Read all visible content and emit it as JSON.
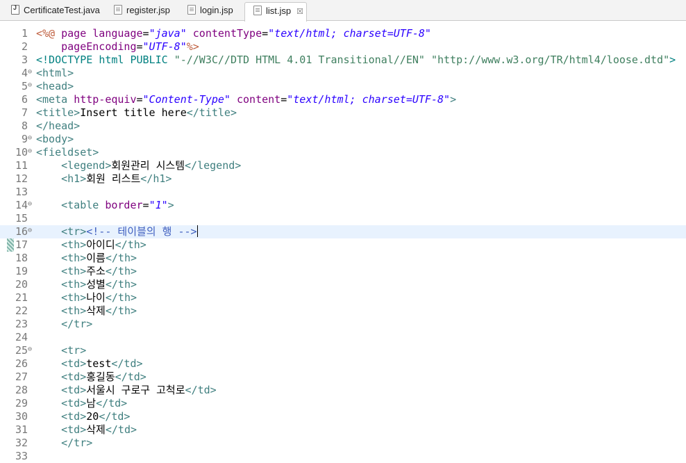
{
  "tabs": [
    {
      "label": "CertificateTest.java",
      "icon": "java-file-icon"
    },
    {
      "label": "register.jsp",
      "icon": "jsp-file-icon"
    },
    {
      "label": "login.jsp",
      "icon": "jsp-file-icon"
    },
    {
      "label": "list.jsp",
      "icon": "jsp-file-icon",
      "active": true
    }
  ],
  "tab_close_glyph": "☒",
  "fold_glyph": "⊖",
  "current_line": 16,
  "lines": [
    {
      "n": "1",
      "code": [
        [
          "dir",
          "<%@ "
        ],
        [
          "attr",
          "page "
        ],
        [
          "attr",
          "language"
        ],
        [
          "",
          "="
        ],
        [
          "val",
          "\"java\""
        ],
        [
          "",
          ""
        ],
        [
          "attr",
          " contentType"
        ],
        [
          "",
          "="
        ],
        [
          "val",
          "\"text/html; charset=UTF-8\""
        ]
      ]
    },
    {
      "n": "2",
      "code": [
        [
          "",
          "    "
        ],
        [
          "attr",
          "pageEncoding"
        ],
        [
          "",
          "="
        ],
        [
          "val",
          "\"UTF-8\""
        ],
        [
          "dir",
          "%>"
        ]
      ]
    },
    {
      "n": "3",
      "code": [
        [
          "dt",
          "<!DOCTYPE "
        ],
        [
          "dt",
          "html "
        ],
        [
          "dt",
          "PUBLIC "
        ],
        [
          "dstr",
          "\"-//W3C//DTD HTML 4.01 Transitional//EN\" \"http://www.w3.org/TR/html4/loose.dtd\""
        ],
        [
          "dt",
          ">"
        ]
      ]
    },
    {
      "n": "4",
      "fold": true,
      "code": [
        [
          "tag",
          "<html>"
        ]
      ]
    },
    {
      "n": "5",
      "fold": true,
      "code": [
        [
          "tag",
          "<head>"
        ]
      ]
    },
    {
      "n": "6",
      "code": [
        [
          "tag",
          "<meta "
        ],
        [
          "attr",
          "http-equiv"
        ],
        [
          "",
          "="
        ],
        [
          "val",
          "\"Content-Type\""
        ],
        [
          "attr",
          " content"
        ],
        [
          "",
          "="
        ],
        [
          "val",
          "\"text/html; charset=UTF-8\""
        ],
        [
          "tag",
          ">"
        ]
      ]
    },
    {
      "n": "7",
      "code": [
        [
          "tag",
          "<title>"
        ],
        [
          "",
          "Insert title here"
        ],
        [
          "tag",
          "</title>"
        ]
      ]
    },
    {
      "n": "8",
      "code": [
        [
          "tag",
          "</head>"
        ]
      ]
    },
    {
      "n": "9",
      "fold": true,
      "code": [
        [
          "tag",
          "<body>"
        ]
      ]
    },
    {
      "n": "10",
      "fold": true,
      "code": [
        [
          "tag",
          "<fieldset>"
        ]
      ]
    },
    {
      "n": "11",
      "code": [
        [
          "",
          "    "
        ],
        [
          "tag",
          "<legend>"
        ],
        [
          "",
          "회원관리 시스템"
        ],
        [
          "tag",
          "</legend>"
        ]
      ]
    },
    {
      "n": "12",
      "code": [
        [
          "",
          "    "
        ],
        [
          "tag",
          "<h1>"
        ],
        [
          "",
          "회원 리스트"
        ],
        [
          "tag",
          "</h1>"
        ]
      ]
    },
    {
      "n": "13",
      "code": []
    },
    {
      "n": "14",
      "fold": true,
      "code": [
        [
          "",
          "    "
        ],
        [
          "tag",
          "<table "
        ],
        [
          "attr",
          "border"
        ],
        [
          "",
          "="
        ],
        [
          "val",
          "\"1\""
        ],
        [
          "tag",
          ">"
        ]
      ]
    },
    {
      "n": "15",
      "code": []
    },
    {
      "n": "16",
      "fold": true,
      "code": [
        [
          "",
          "    "
        ],
        [
          "tag",
          "<tr>"
        ],
        [
          "cmt",
          "<!-- 테이블의 행 -->"
        ]
      ]
    },
    {
      "n": "17",
      "code": [
        [
          "",
          "    "
        ],
        [
          "tag",
          "<th>"
        ],
        [
          "",
          "아이디"
        ],
        [
          "tag",
          "</th>"
        ]
      ]
    },
    {
      "n": "18",
      "code": [
        [
          "",
          "    "
        ],
        [
          "tag",
          "<th>"
        ],
        [
          "",
          "이름"
        ],
        [
          "tag",
          "</th>"
        ]
      ]
    },
    {
      "n": "19",
      "code": [
        [
          "",
          "    "
        ],
        [
          "tag",
          "<th>"
        ],
        [
          "",
          "주소"
        ],
        [
          "tag",
          "</th>"
        ]
      ]
    },
    {
      "n": "20",
      "code": [
        [
          "",
          "    "
        ],
        [
          "tag",
          "<th>"
        ],
        [
          "",
          "성별"
        ],
        [
          "tag",
          "</th>"
        ]
      ]
    },
    {
      "n": "21",
      "code": [
        [
          "",
          "    "
        ],
        [
          "tag",
          "<th>"
        ],
        [
          "",
          "나이"
        ],
        [
          "tag",
          "</th>"
        ]
      ]
    },
    {
      "n": "22",
      "code": [
        [
          "",
          "    "
        ],
        [
          "tag",
          "<th>"
        ],
        [
          "",
          "삭제"
        ],
        [
          "tag",
          "</th>"
        ]
      ]
    },
    {
      "n": "23",
      "code": [
        [
          "",
          "    "
        ],
        [
          "tag",
          "</tr>"
        ]
      ]
    },
    {
      "n": "24",
      "code": []
    },
    {
      "n": "25",
      "fold": true,
      "code": [
        [
          "",
          "    "
        ],
        [
          "tag",
          "<tr>"
        ]
      ]
    },
    {
      "n": "26",
      "code": [
        [
          "",
          "    "
        ],
        [
          "tag",
          "<td>"
        ],
        [
          "",
          "test"
        ],
        [
          "tag",
          "</td>"
        ]
      ]
    },
    {
      "n": "27",
      "code": [
        [
          "",
          "    "
        ],
        [
          "tag",
          "<td>"
        ],
        [
          "",
          "홍길동"
        ],
        [
          "tag",
          "</td>"
        ]
      ]
    },
    {
      "n": "28",
      "code": [
        [
          "",
          "    "
        ],
        [
          "tag",
          "<td>"
        ],
        [
          "",
          "서울시 구로구 고척로"
        ],
        [
          "tag",
          "</td>"
        ]
      ]
    },
    {
      "n": "29",
      "code": [
        [
          "",
          "    "
        ],
        [
          "tag",
          "<td>"
        ],
        [
          "",
          "남"
        ],
        [
          "tag",
          "</td>"
        ]
      ]
    },
    {
      "n": "30",
      "code": [
        [
          "",
          "    "
        ],
        [
          "tag",
          "<td>"
        ],
        [
          "",
          "20"
        ],
        [
          "tag",
          "</td>"
        ]
      ]
    },
    {
      "n": "31",
      "code": [
        [
          "",
          "    "
        ],
        [
          "tag",
          "<td>"
        ],
        [
          "",
          "삭제"
        ],
        [
          "tag",
          "</td>"
        ]
      ]
    },
    {
      "n": "32",
      "code": [
        [
          "",
          "    "
        ],
        [
          "tag",
          "</tr>"
        ]
      ]
    },
    {
      "n": "33",
      "code": []
    }
  ]
}
